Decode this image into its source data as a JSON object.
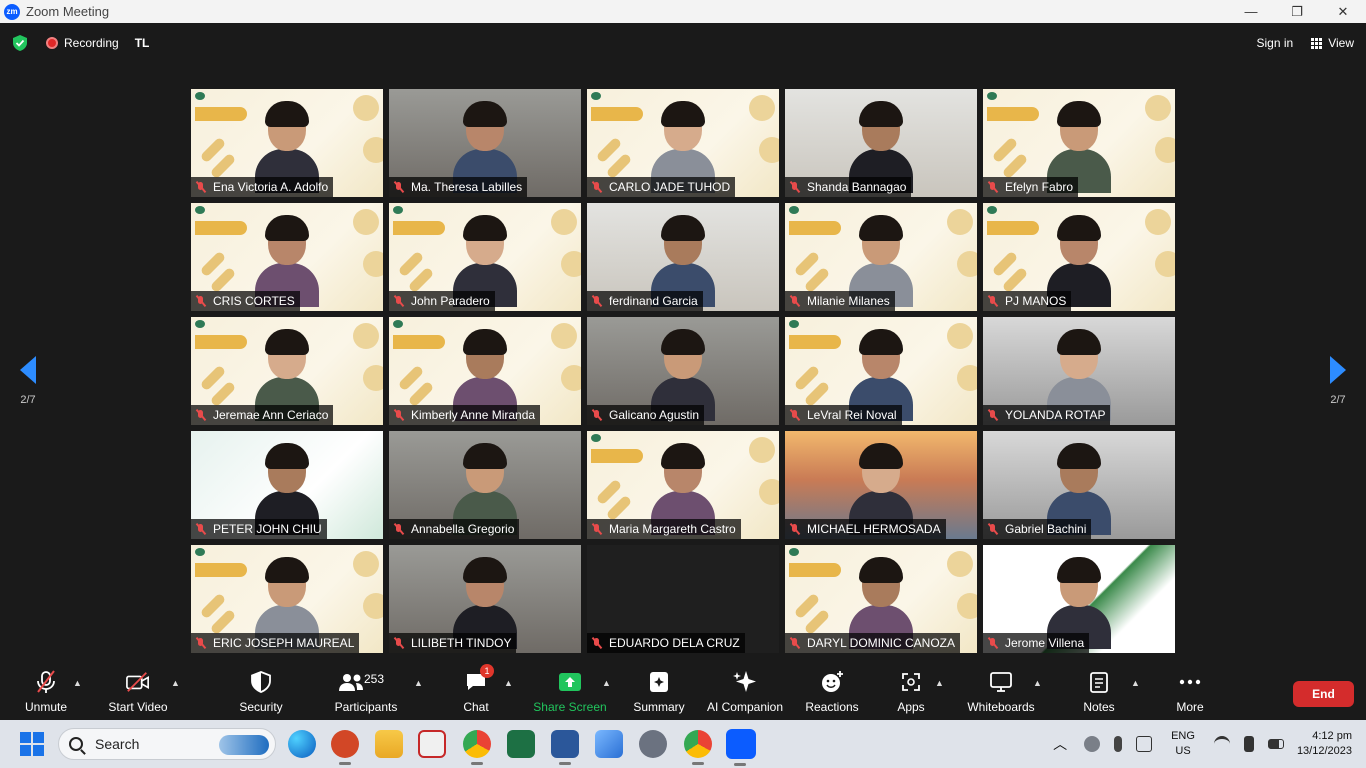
{
  "window": {
    "title": "Zoom Meeting",
    "logo_text": "zm",
    "minimize": "—",
    "restore": "❐",
    "close": "✕"
  },
  "topbar": {
    "recording_label": "Recording",
    "host_initials": "TL",
    "signin_label": "Sign in",
    "view_label": "View"
  },
  "pagination": {
    "left_label": "2/7",
    "right_label": "2/7"
  },
  "participants": [
    {
      "name": "Ena Victoria A. Adolfo",
      "bg": "cream"
    },
    {
      "name": "Ma. Theresa Labilles",
      "bg": "room"
    },
    {
      "name": "CARLO JADE TUHOD",
      "bg": "cream"
    },
    {
      "name": "Shanda Bannagao",
      "bg": "red"
    },
    {
      "name": "Efelyn Fabro",
      "bg": "cream"
    },
    {
      "name": "CRIS CORTES",
      "bg": "cream"
    },
    {
      "name": "John Paradero",
      "bg": "cream"
    },
    {
      "name": "ferdinand Garcia",
      "bg": "red"
    },
    {
      "name": "Milanie Milanes",
      "bg": "cream"
    },
    {
      "name": "PJ MANOS",
      "bg": "cream"
    },
    {
      "name": "Jeremae Ann Ceriaco",
      "bg": "cream"
    },
    {
      "name": "Kimberly Anne Miranda",
      "bg": "cream"
    },
    {
      "name": "Galicano Agustin",
      "bg": "room"
    },
    {
      "name": "LeVral Rei Noval",
      "bg": "cream"
    },
    {
      "name": "YOLANDA ROTAP",
      "bg": "office"
    },
    {
      "name": "PETER JOHN CHIU",
      "bg": "green"
    },
    {
      "name": "Annabella Gregorio",
      "bg": "room"
    },
    {
      "name": "Maria Margareth Castro",
      "bg": "cream"
    },
    {
      "name": "MICHAEL HERMOSADA",
      "bg": "bridge"
    },
    {
      "name": "Gabriel Bachini",
      "bg": "office"
    },
    {
      "name": "ERIC JOSEPH MAUREAL",
      "bg": "cream"
    },
    {
      "name": "LILIBETH TINDOY",
      "bg": "room"
    },
    {
      "name": "EDUARDO DELA CRUZ",
      "bg": "black"
    },
    {
      "name": "DARYL DOMINIC CANOZA",
      "bg": "cream"
    },
    {
      "name": "Jerome Villena",
      "bg": "remote"
    }
  ],
  "toolbar": {
    "unmute": "Unmute",
    "start_video": "Start Video",
    "security": "Security",
    "participants": "Participants",
    "participants_count": "253",
    "chat": "Chat",
    "chat_badge": "1",
    "share_screen": "Share Screen",
    "summary": "Summary",
    "ai_companion": "AI Companion",
    "reactions": "Reactions",
    "apps": "Apps",
    "whiteboards": "Whiteboards",
    "notes": "Notes",
    "more": "More",
    "end": "End"
  },
  "taskbar": {
    "search_placeholder": "Search",
    "lang_top": "ENG",
    "lang_bottom": "US",
    "time": "4:12 pm",
    "date": "13/12/2023"
  },
  "colors": {
    "accent": "#2d8cff",
    "end_red": "#d42c2c",
    "share_green": "#21c55d"
  }
}
